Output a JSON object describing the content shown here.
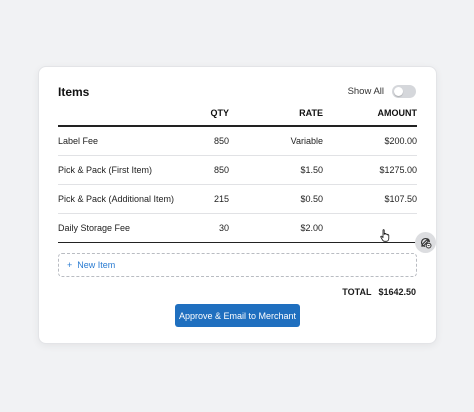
{
  "card": {
    "title": "Items",
    "show_all_label": "Show All",
    "show_all_enabled": false
  },
  "table": {
    "headers": {
      "qty": "QTY",
      "rate": "RATE",
      "amount": "AMOUNT"
    },
    "rows": [
      {
        "description": "Label Fee",
        "qty": "850",
        "rate": "Variable",
        "amount": "$200.00"
      },
      {
        "description": "Pick & Pack (First Item)",
        "qty": "850",
        "rate": "$1.50",
        "amount": "$1275.00"
      },
      {
        "description": "Pick & Pack (Additional Item)",
        "qty": "215",
        "rate": "$0.50",
        "amount": "$107.50"
      },
      {
        "description": "Daily Storage Fee",
        "qty": "30",
        "rate": "$2.00",
        "amount": ""
      }
    ]
  },
  "new_item": {
    "plus": "+",
    "label": "New Item"
  },
  "total": {
    "label": "TOTAL",
    "value": "$1642.50"
  },
  "approve_button": {
    "label": "Approve & Email to Merchant"
  },
  "colors": {
    "accent": "#1f6fbf",
    "link": "#2a7bd1"
  },
  "icons": {
    "edit": "pencil-icon",
    "delete": "delete-icon",
    "cursor": "hand-pointer-icon"
  }
}
